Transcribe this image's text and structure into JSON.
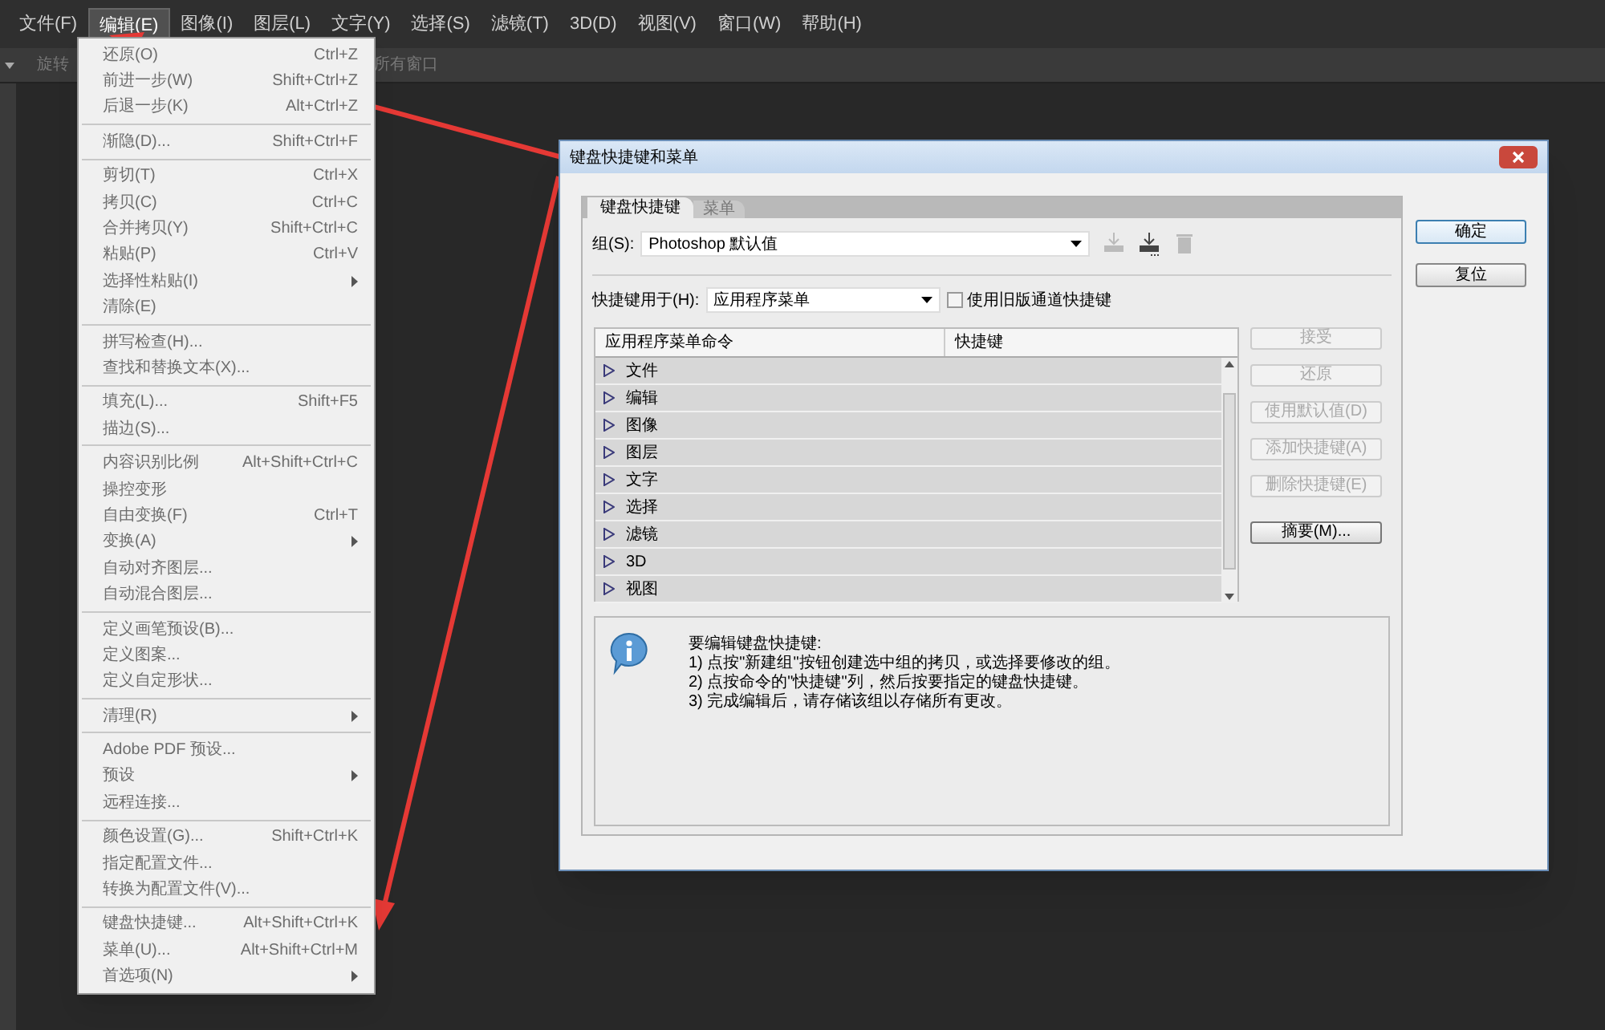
{
  "menu_bar": [
    {
      "label": "文件(F)",
      "selected": false
    },
    {
      "label": "编辑(E)",
      "selected": true
    },
    {
      "label": "图像(I)",
      "selected": false
    },
    {
      "label": "图层(L)",
      "selected": false
    },
    {
      "label": "文字(Y)",
      "selected": false
    },
    {
      "label": "选择(S)",
      "selected": false
    },
    {
      "label": "滤镜(T)",
      "selected": false
    },
    {
      "label": "3D(D)",
      "selected": false
    },
    {
      "label": "视图(V)",
      "selected": false
    },
    {
      "label": "窗口(W)",
      "selected": false
    },
    {
      "label": "帮助(H)",
      "selected": false
    }
  ],
  "options_bar": {
    "rotate_label": "旋转",
    "all_windows_label": "所有窗口"
  },
  "edit_menu": {
    "groups": [
      {
        "items": [
          {
            "label": "还原(O)",
            "shortcut": "Ctrl+Z",
            "submenu": false
          },
          {
            "label": "前进一步(W)",
            "shortcut": "Shift+Ctrl+Z",
            "submenu": false
          },
          {
            "label": "后退一步(K)",
            "shortcut": "Alt+Ctrl+Z",
            "submenu": false
          }
        ]
      },
      {
        "items": [
          {
            "label": "渐隐(D)...",
            "shortcut": "Shift+Ctrl+F",
            "submenu": false
          }
        ]
      },
      {
        "items": [
          {
            "label": "剪切(T)",
            "shortcut": "Ctrl+X",
            "submenu": false
          },
          {
            "label": "拷贝(C)",
            "shortcut": "Ctrl+C",
            "submenu": false
          },
          {
            "label": "合并拷贝(Y)",
            "shortcut": "Shift+Ctrl+C",
            "submenu": false
          },
          {
            "label": "粘贴(P)",
            "shortcut": "Ctrl+V",
            "submenu": false
          },
          {
            "label": "选择性粘贴(I)",
            "submenu": true
          },
          {
            "label": "清除(E)",
            "submenu": false
          }
        ]
      },
      {
        "items": [
          {
            "label": "拼写检查(H)...",
            "submenu": false
          },
          {
            "label": "查找和替换文本(X)...",
            "submenu": false
          }
        ]
      },
      {
        "items": [
          {
            "label": "填充(L)...",
            "shortcut": "Shift+F5",
            "submenu": false
          },
          {
            "label": "描边(S)...",
            "submenu": false
          }
        ]
      },
      {
        "items": [
          {
            "label": "内容识别比例",
            "shortcut": "Alt+Shift+Ctrl+C",
            "submenu": false
          },
          {
            "label": "操控变形",
            "submenu": false
          },
          {
            "label": "自由变换(F)",
            "shortcut": "Ctrl+T",
            "submenu": false
          },
          {
            "label": "变换(A)",
            "submenu": true
          },
          {
            "label": "自动对齐图层...",
            "submenu": false
          },
          {
            "label": "自动混合图层...",
            "submenu": false
          }
        ]
      },
      {
        "items": [
          {
            "label": "定义画笔预设(B)...",
            "submenu": false
          },
          {
            "label": "定义图案...",
            "submenu": false
          },
          {
            "label": "定义自定形状...",
            "submenu": false
          }
        ]
      },
      {
        "items": [
          {
            "label": "清理(R)",
            "submenu": true
          }
        ]
      },
      {
        "items": [
          {
            "label": "Adobe PDF 预设...",
            "submenu": false
          },
          {
            "label": "预设",
            "submenu": true
          },
          {
            "label": "远程连接...",
            "submenu": false
          }
        ]
      },
      {
        "items": [
          {
            "label": "颜色设置(G)...",
            "shortcut": "Shift+Ctrl+K",
            "submenu": false
          },
          {
            "label": "指定配置文件...",
            "submenu": false
          },
          {
            "label": "转换为配置文件(V)...",
            "submenu": false
          }
        ]
      },
      {
        "items": [
          {
            "label": "键盘快捷键...",
            "shortcut": "Alt+Shift+Ctrl+K",
            "submenu": false
          },
          {
            "label": "菜单(U)...",
            "shortcut": "Alt+Shift+Ctrl+M",
            "submenu": false
          },
          {
            "label": "首选项(N)",
            "submenu": true
          }
        ]
      }
    ]
  },
  "dialog": {
    "title": "键盘快捷键和菜单",
    "tabs": [
      {
        "label": "键盘快捷键",
        "selected": true
      },
      {
        "label": "菜单",
        "selected": false
      }
    ],
    "set_label": "组(S):",
    "set_value": "Photoshop 默认值",
    "set_icons": [
      {
        "kind": "save",
        "disabled": true
      },
      {
        "kind": "save-as",
        "disabled": false
      },
      {
        "kind": "delete",
        "disabled": true
      }
    ],
    "for_label": "快捷键用于(H):",
    "for_value": "应用程序菜单",
    "legacy_checkbox": {
      "label": "使用旧版通道快捷键",
      "checked": false
    },
    "table": {
      "columns": [
        "应用程序菜单命令",
        "快捷键"
      ],
      "rows": [
        {
          "label": "文件",
          "expanded": false
        },
        {
          "label": "编辑",
          "expanded": false
        },
        {
          "label": "图像",
          "expanded": false
        },
        {
          "label": "图层",
          "expanded": false
        },
        {
          "label": "文字",
          "expanded": false
        },
        {
          "label": "选择",
          "expanded": false
        },
        {
          "label": "滤镜",
          "expanded": false
        },
        {
          "label": "3D",
          "expanded": false
        },
        {
          "label": "视图",
          "expanded": false
        }
      ]
    },
    "side_buttons": [
      {
        "label": "接受",
        "disabled": true
      },
      {
        "label": "还原",
        "disabled": true
      },
      {
        "label": "使用默认值(D)",
        "disabled": true
      },
      {
        "label": "添加快捷键(A)",
        "disabled": true
      },
      {
        "label": "删除快捷键(E)",
        "disabled": true
      },
      {
        "label": "摘要(M)...",
        "disabled": false
      }
    ],
    "info_lines": [
      "要编辑键盘快捷键:",
      "1) 点按\"新建组\"按钮创建选中组的拷贝，或选择要修改的组。",
      "2) 点按命令的\"快捷键\"列，然后按要指定的键盘快捷键。",
      "3) 完成编辑后，请存储该组以存储所有更改。"
    ],
    "buttons": [
      {
        "label": "确定",
        "default": true
      },
      {
        "label": "复位",
        "default": false
      }
    ]
  }
}
